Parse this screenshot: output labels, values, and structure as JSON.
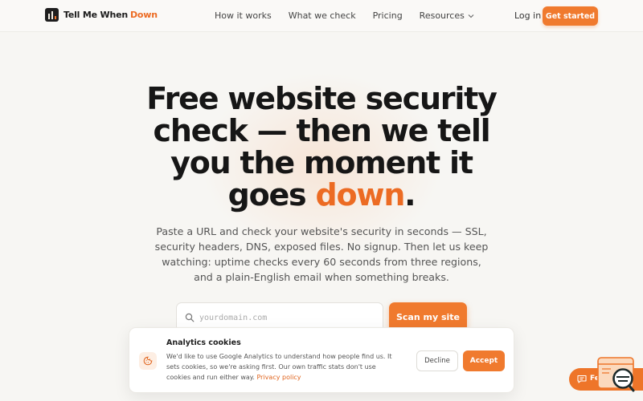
{
  "brand": {
    "name_main": "Tell Me When",
    "name_accent": "Down"
  },
  "nav": {
    "links": [
      "How it works",
      "What we check",
      "Pricing",
      "Resources"
    ],
    "login": "Log in",
    "cta": "Get started"
  },
  "hero": {
    "headline_main": "Free website security check — then we tell you the moment it goes",
    "headline_accent": "down",
    "headline_end": ".",
    "subtext": "Paste a URL and check your website's security in seconds — SSL, security headers, DNS, exposed files. No signup. Then let us keep watching: uptime checks every 60 seconds from three regions, and a plain-English email when something breaks."
  },
  "search": {
    "placeholder": "yourdomain.com",
    "value": "",
    "button": "Scan my site"
  },
  "cookie": {
    "title": "Analytics cookies",
    "text": "We'd like to use Google Analytics to understand how people find us. It sets cookies, so we're asking first. Our own traffic stats don't use cookies and run either way.",
    "policy_link": "Privacy policy",
    "decline": "Decline",
    "accept": "Accept"
  },
  "feedback": {
    "label": "Feedback"
  },
  "icons": {
    "search": "search-icon",
    "cookie": "cookie-icon",
    "feedback": "chat-icon",
    "chevron": "chevron-down-icon"
  },
  "colors": {
    "accent": "#f07a2e",
    "accent_text": "#ec6b23",
    "background": "#f7f6f3",
    "text": "#161616"
  }
}
